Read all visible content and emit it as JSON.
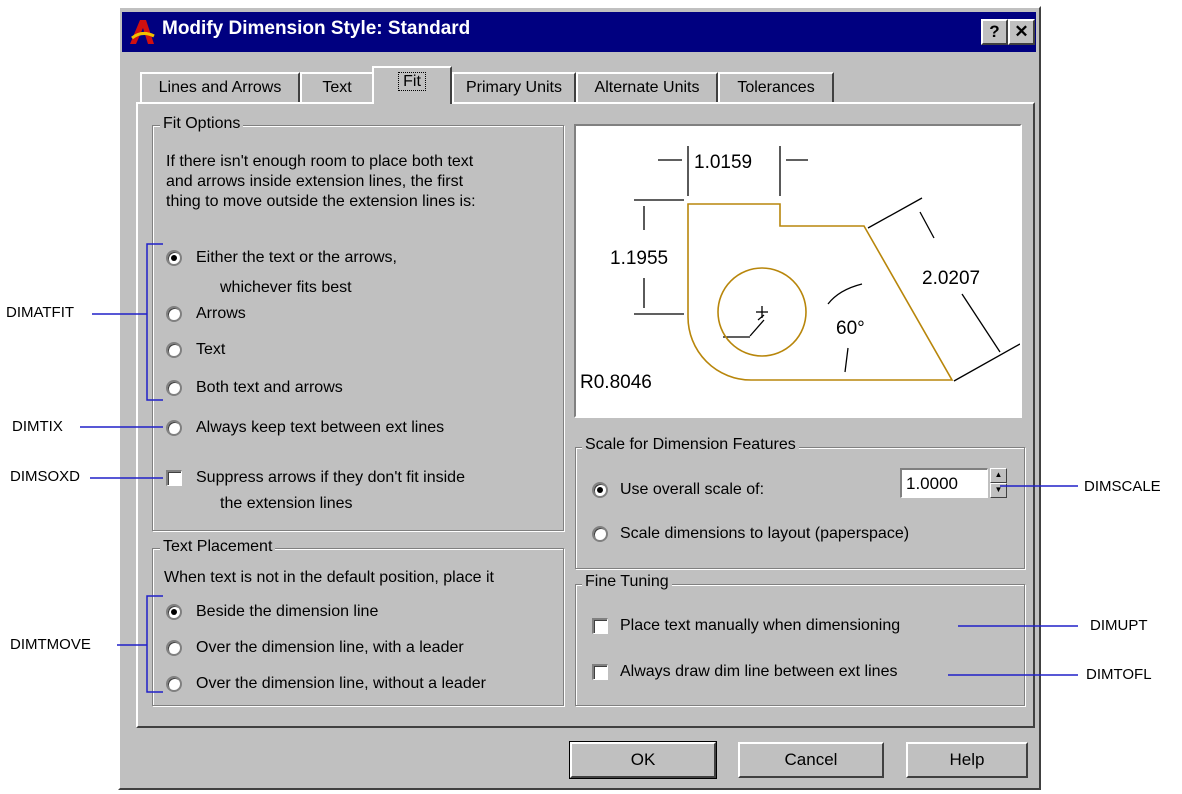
{
  "window": {
    "title": "Modify Dimension Style: Standard",
    "help_btn": "?",
    "close_btn": "✕"
  },
  "tabs": [
    "Lines and Arrows",
    "Text",
    "Fit",
    "Primary Units",
    "Alternate Units",
    "Tolerances"
  ],
  "active_tab": "Fit",
  "fit_options": {
    "legend": "Fit Options",
    "description": [
      "If there isn't enough room to place both text",
      "and arrows inside extension lines, the first",
      "thing to move outside the extension lines is:"
    ],
    "option_either_line1": "Either the text or the arrows,",
    "option_either_line2": "whichever fits best",
    "option_arrows": "Arrows",
    "option_text": "Text",
    "option_both": "Both text and arrows",
    "option_always_keep": "Always keep text between ext lines",
    "suppress_line1": "Suppress arrows if they don't fit inside",
    "suppress_line2": "the extension lines"
  },
  "text_placement": {
    "legend": "Text Placement",
    "description": "When text is not in the default position, place it",
    "option_beside": "Beside the dimension line",
    "option_over_leader": "Over the dimension line, with a leader",
    "option_over_no_leader": "Over the dimension line, without a leader"
  },
  "preview": {
    "dim_top": "1.0159",
    "dim_left": "1.1955",
    "dim_right": "2.0207",
    "angle": "60°",
    "radius": "R0.8046"
  },
  "scale": {
    "legend": "Scale for Dimension Features",
    "option_overall": "Use overall scale of:",
    "overall_value": "1.0000",
    "option_layout": "Scale dimensions to layout (paperspace)"
  },
  "fine_tuning": {
    "legend": "Fine Tuning",
    "place_manually": "Place text manually when dimensioning",
    "always_draw": "Always draw dim line between ext lines"
  },
  "buttons": {
    "ok": "OK",
    "cancel": "Cancel",
    "help": "Help"
  },
  "annotations": {
    "dimatfit": "DIMATFIT",
    "dimtix": "DIMTIX",
    "dimsoxd": "DIMSOXD",
    "dimtmove": "DIMTMOVE",
    "dimscale": "DIMSCALE",
    "dimupt": "DIMUPT",
    "dimtofl": "DIMTOFL"
  },
  "colors": {
    "titlebar": "#000080",
    "dialog_face": "#c0c0c0",
    "annotation_line": "#2020c8",
    "preview_geometry": "#b8860b"
  }
}
